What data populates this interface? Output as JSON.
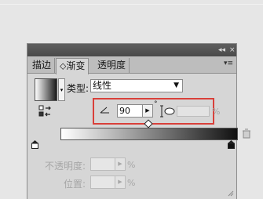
{
  "panel": {
    "collapse_label": "◂◂",
    "close_label": "×",
    "menu_label": "▾≡"
  },
  "tabs": [
    {
      "label": "描边",
      "active": false
    },
    {
      "label": "⬦渐变",
      "active": true
    },
    {
      "label": "透明度",
      "active": false
    }
  ],
  "type": {
    "label": "类型:",
    "value": "线性"
  },
  "angle": {
    "value": "90",
    "degree_symbol": "°"
  },
  "aspect": {
    "percent_label": "%"
  },
  "opacity": {
    "label": "不透明度:",
    "percent_label": "%"
  },
  "location": {
    "label": "位置:",
    "percent_label": "%"
  },
  "colors": {
    "highlight": "#d9403a",
    "ramp_start": "#ffffff",
    "ramp_end": "#111111"
  }
}
